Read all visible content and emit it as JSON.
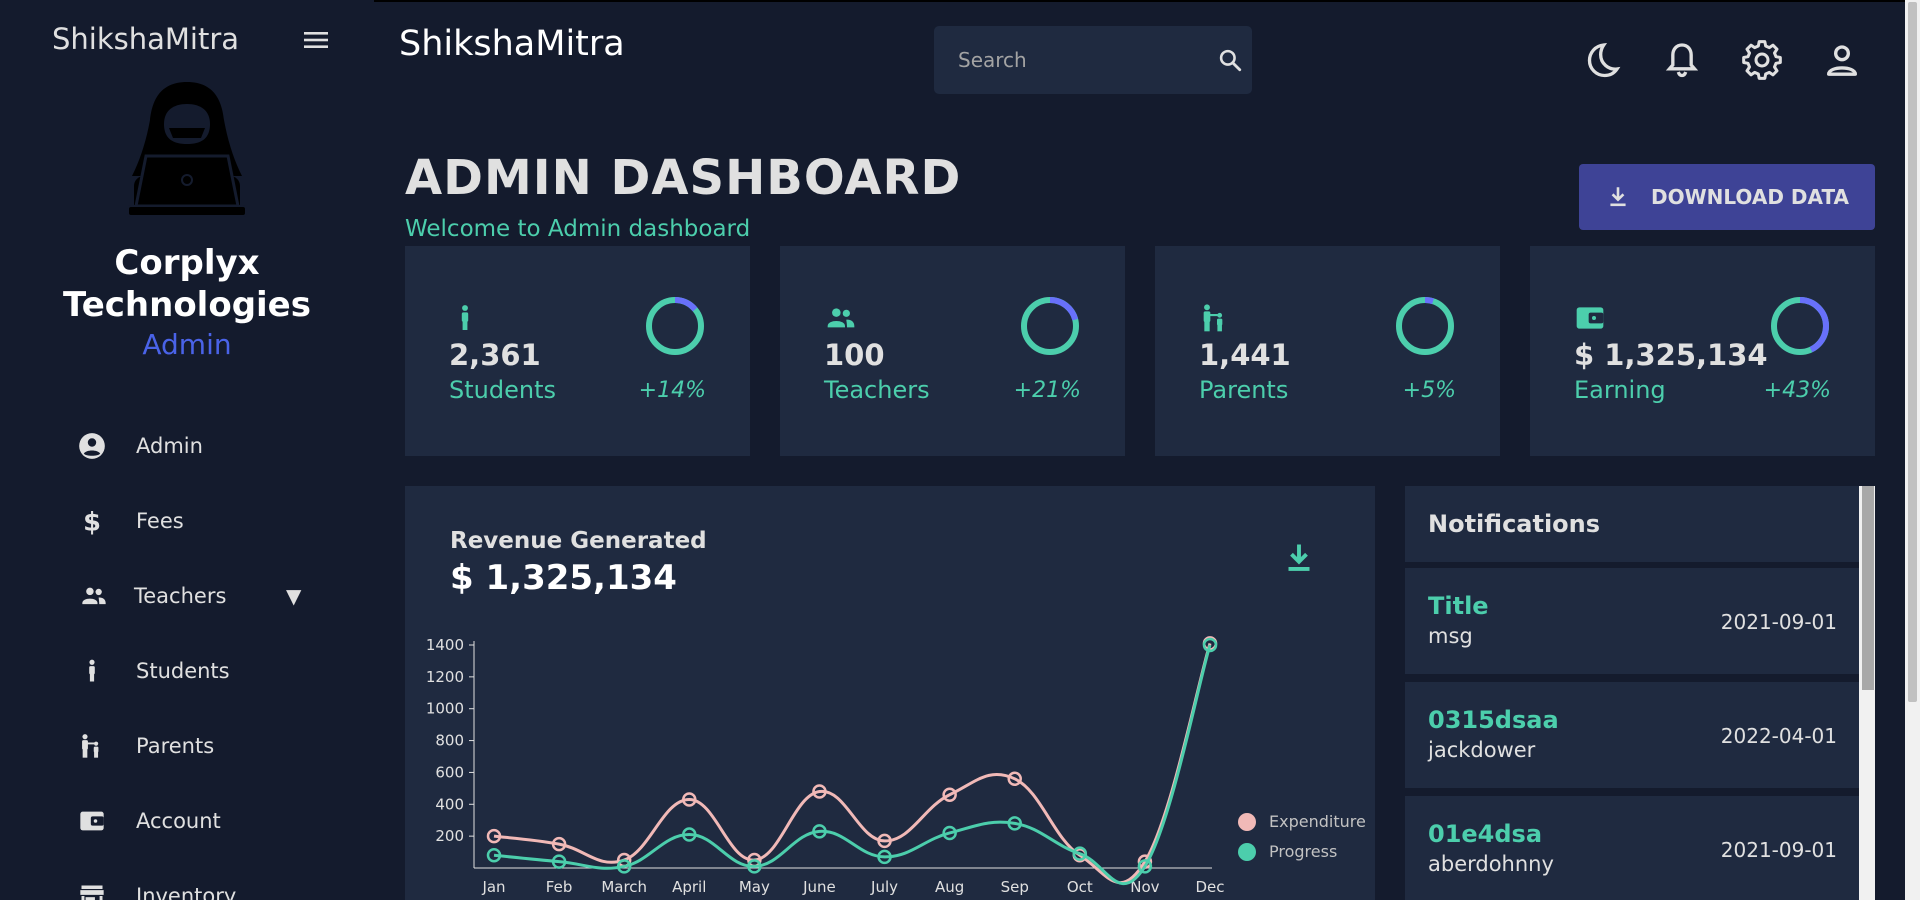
{
  "sidebar": {
    "brand": "ShikshaMitra",
    "org_name_line1": "Corplyx",
    "org_name_line2": "Technologies",
    "role": "Admin",
    "items": [
      {
        "label": "Admin",
        "icon": "account-circle-icon"
      },
      {
        "label": "Fees",
        "icon": "dollar-icon"
      },
      {
        "label": "Teachers",
        "icon": "people-icon",
        "caret": "▼"
      },
      {
        "label": "Students",
        "icon": "person-icon"
      },
      {
        "label": "Parents",
        "icon": "family-icon"
      },
      {
        "label": "Account",
        "icon": "wallet-icon"
      },
      {
        "label": "Inventory",
        "icon": "store-icon"
      }
    ]
  },
  "topbar": {
    "title": "ShikshaMitra",
    "search_placeholder": "Search",
    "icons": [
      "dark-mode-icon",
      "notifications-icon",
      "settings-icon",
      "user-icon"
    ]
  },
  "header": {
    "title": "ADMIN DASHBOARD",
    "subtitle": "Welcome to Admin dashboard",
    "download_label": "DOWNLOAD DATA"
  },
  "stats": [
    {
      "value": "2,361",
      "label": "Students",
      "increase": "+14%",
      "progress": 0.14,
      "icon": "person-icon"
    },
    {
      "value": "100",
      "label": "Teachers",
      "increase": "+21%",
      "progress": 0.21,
      "icon": "people-icon"
    },
    {
      "value": "1,441",
      "label": "Parents",
      "increase": "+5%",
      "progress": 0.05,
      "icon": "family-icon"
    },
    {
      "value": "$ 1,325,134",
      "label": "Earning",
      "increase": "+43%",
      "progress": 0.43,
      "icon": "wallet-icon"
    }
  ],
  "revenue": {
    "title": "Revenue Generated",
    "value": "$ 1,325,134"
  },
  "chart_data": {
    "type": "line",
    "categories": [
      "Jan",
      "Feb",
      "March",
      "April",
      "May",
      "June",
      "July",
      "Aug",
      "Sep",
      "Oct",
      "Nov",
      "Dec"
    ],
    "series": [
      {
        "name": "Expenditure",
        "color": "#f1b9b7",
        "values": [
          200,
          150,
          50,
          430,
          50,
          480,
          170,
          460,
          560,
          80,
          40,
          1410
        ]
      },
      {
        "name": "Progress",
        "color": "#4cceac",
        "values": [
          80,
          40,
          10,
          210,
          10,
          230,
          70,
          220,
          280,
          90,
          10,
          1400
        ]
      }
    ],
    "yticks": [
      200,
      400,
      600,
      800,
      1000,
      1200,
      1400
    ],
    "ylim": [
      0,
      1400
    ],
    "legend_position": "bottom-right",
    "grid": false
  },
  "notifications": {
    "title": "Notifications",
    "items": [
      {
        "title": "Title",
        "msg": "msg",
        "date": "2021-09-01"
      },
      {
        "title": "0315dsaa",
        "msg": "jackdower",
        "date": "2022-04-01"
      },
      {
        "title": "01e4dsa",
        "msg": "aberdohnny",
        "date": "2021-09-01"
      }
    ]
  },
  "colors": {
    "background": "#141b2d",
    "panel": "#1f2a40",
    "accent_green": "#4cceac",
    "accent_blue": "#4a63e8",
    "button": "#3e4396",
    "ring_blue": "#6870fa"
  }
}
